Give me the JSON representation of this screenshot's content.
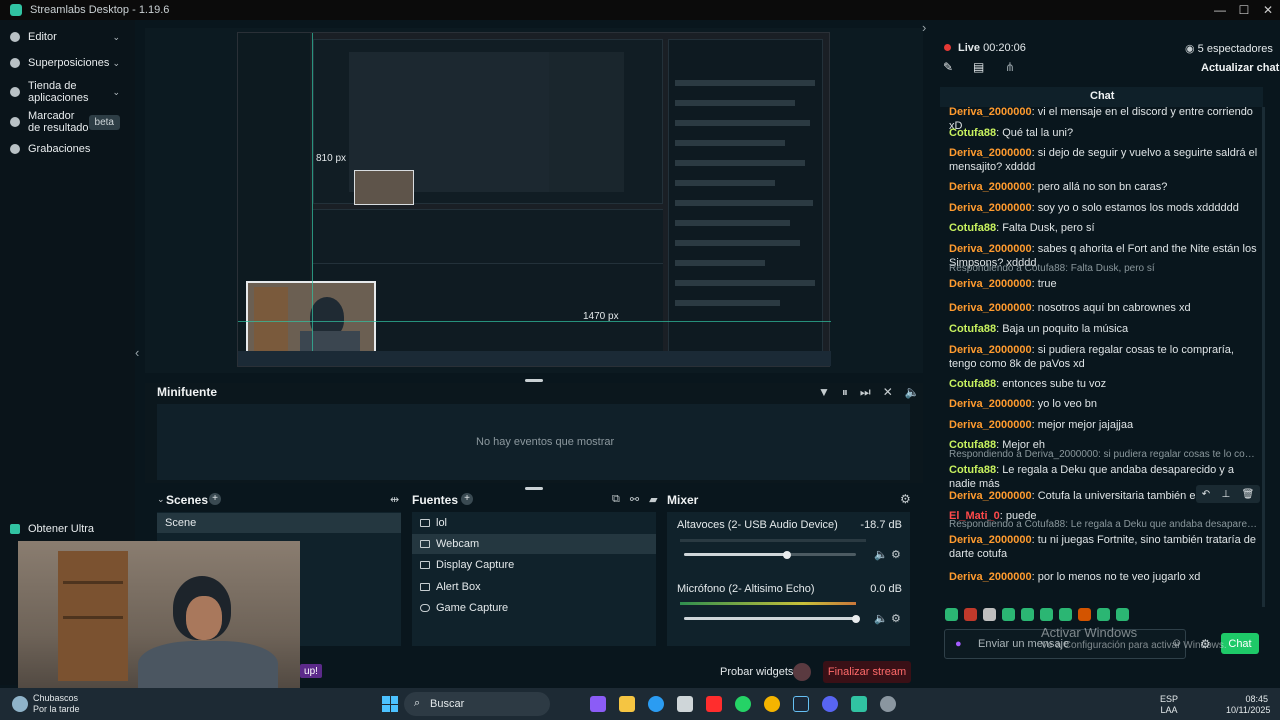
{
  "window": {
    "title": "Streamlabs Desktop - 1.19.6"
  },
  "sidebar": {
    "items": [
      {
        "label": "Editor"
      },
      {
        "label": "Superposiciones"
      },
      {
        "label": "Tienda de aplicaciones"
      },
      {
        "label": "Marcador de resultado",
        "badge": "beta"
      },
      {
        "label": "Grabaciones"
      }
    ],
    "obtain_ultra": "Obtener Ultra"
  },
  "preview": {
    "measure_height": "810 px",
    "measure_width": "1470 px"
  },
  "minifuente": {
    "title": "Minifuente",
    "empty": "No hay eventos que mostrar"
  },
  "scenes": {
    "title": "Scenes",
    "items": [
      "Scene"
    ]
  },
  "sources": {
    "title": "Fuentes",
    "items": [
      "lol",
      "Webcam",
      "Display Capture",
      "Alert Box",
      "Game Capture"
    ]
  },
  "mixer": {
    "title": "Mixer",
    "tracks": [
      {
        "name": "Altavoces (2- USB Audio Device)",
        "db": "-18.7 dB",
        "level": 0.6
      },
      {
        "name": "Micrófono (2- Altisimo Echo)",
        "db": "0.0 dB",
        "level": 1.0
      }
    ]
  },
  "footer": {
    "test_widgets": "Probar widgets",
    "end_stream": "Finalizar stream",
    "up_text": "up!"
  },
  "live": {
    "status": "Live",
    "time": "00:20:06",
    "viewers": "5 espectadores",
    "refresh_chat": "Actualizar chat",
    "chat_title": "Chat"
  },
  "chat": {
    "messages": [
      {
        "user": "Deriva_2000000",
        "color": "orange",
        "text": "vi el mensaje en el discord y entre corriendo xD"
      },
      {
        "user": "Cotufa88",
        "color": "green",
        "text": "Qué tal la uni?"
      },
      {
        "user": "Deriva_2000000",
        "color": "orange",
        "text": "si dejo de seguir y vuelvo a seguirte saldrá el mensajito? xdddd"
      },
      {
        "user": "Deriva_2000000",
        "color": "orange",
        "text": "pero allá no son bn caras?"
      },
      {
        "user": "Deriva_2000000",
        "color": "orange",
        "text": "soy yo o solo estamos los mods xdddddd"
      },
      {
        "user": "Cotufa88",
        "color": "green",
        "text": "Falta Dusk, pero sí"
      },
      {
        "user": "Deriva_2000000",
        "color": "orange",
        "text": "sabes q ahorita el Fort and the Nite están los Simpsons? xdddd"
      },
      {
        "reply": "Respondiendo a Cotufa88: Falta Dusk, pero sí",
        "user": "Deriva_2000000",
        "color": "orange",
        "text": "true"
      },
      {
        "user": "Deriva_2000000",
        "color": "orange",
        "text": "nosotros aquí bn cabrownes xd"
      },
      {
        "user": "Cotufa88",
        "color": "green",
        "text": "Baja un poquito la música"
      },
      {
        "user": "Deriva_2000000",
        "color": "orange",
        "text": "si pudiera regalar cosas te lo compraría, tengo como 8k de paVos xd"
      },
      {
        "user": "Cotufa88",
        "color": "green",
        "text": "entonces sube tu voz"
      },
      {
        "user": "Deriva_2000000",
        "color": "orange",
        "text": "yo lo veo bn"
      },
      {
        "user": "Deriva_2000000",
        "color": "orange",
        "text": "mejor mejor jajajjaa"
      },
      {
        "user": "Cotufa88",
        "color": "green",
        "text": "Mejor eh"
      },
      {
        "reply": "Respondiendo a Deriva_2000000: si pudiera regalar cosas te lo compraría...",
        "user": "Cotufa88",
        "color": "green",
        "text": "Le regala a Deku que andaba desaparecido y a nadie más"
      },
      {
        "user": "Deriva_2000000",
        "color": "orange",
        "text": "Cotufa la universitaria también es xdddd"
      },
      {
        "user": "El_Mati_0",
        "color": "red",
        "text": "puede"
      },
      {
        "reply": "Respondiendo a Cotufa88: Le regala a Deku que andaba desaparecido y a...",
        "user": "Deriva_2000000",
        "color": "orange",
        "text": "tu ni juegas Fortnite, sino también trataría de darte cotufa"
      },
      {
        "user": "Deriva_2000000",
        "color": "orange",
        "text": "por lo menos no te veo jugarlo xd"
      }
    ],
    "input_placeholder": "Enviar un mensaje",
    "send_label": "Chat"
  },
  "activate_windows": {
    "title": "Activar Windows",
    "subtitle": "Ve a Configuración para activar Windows."
  },
  "taskbar": {
    "search_placeholder": "Buscar",
    "weather_title": "Chubascos",
    "weather_sub": "Por la tarde",
    "lang": "ESP",
    "lang_sub": "LAA",
    "time": "08:45",
    "date": "10/11/2025"
  },
  "colors": {
    "accent": "#31c3a2",
    "live_red": "#e53935",
    "orange_user": "#ff9b2f",
    "green_user": "#c8f25f",
    "end_stream_bg": "#3a1016"
  }
}
